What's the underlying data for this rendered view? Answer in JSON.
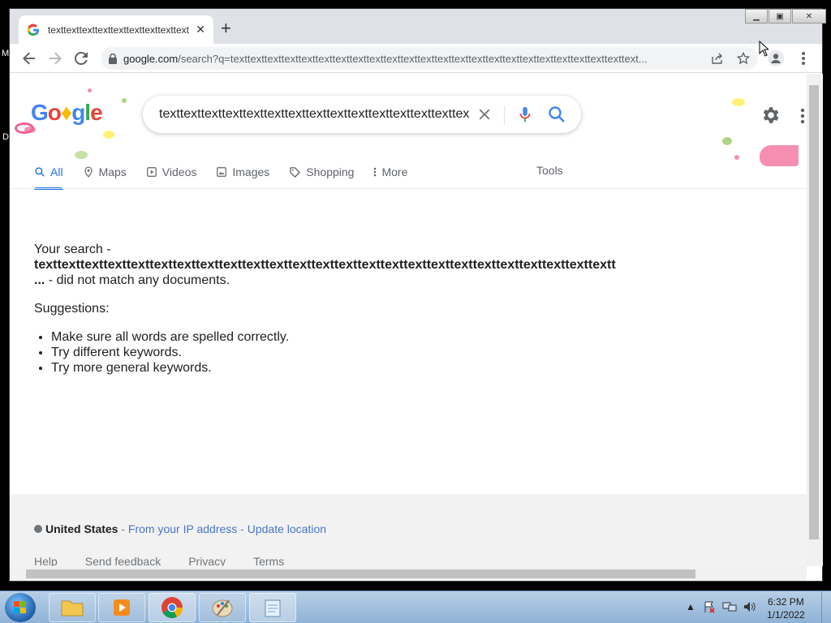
{
  "browser": {
    "tab_title": "texttexttexttexttexttexttexttexttexttexttexttext",
    "new_tab_label": "+",
    "url_domain": "google.com",
    "url_rest": "/search?q=texttexttexttexttexttexttexttexttexttexttexttexttexttexttexttexttexttexttexttexttexttexttexttext..."
  },
  "google": {
    "logo_text": "Google",
    "query": "texttexttexttexttexttexttexttexttexttexttexttexttexttexttexttexttext",
    "tabs": [
      {
        "label": "All",
        "icon": "search-icon"
      },
      {
        "label": "Maps",
        "icon": "map-pin-icon"
      },
      {
        "label": "Videos",
        "icon": "video-icon"
      },
      {
        "label": "Images",
        "icon": "image-icon"
      },
      {
        "label": "Shopping",
        "icon": "tag-icon"
      },
      {
        "label": "More",
        "icon": "more-vert-icon"
      }
    ],
    "tools_label": "Tools",
    "no_results": {
      "prefix": "Your search -",
      "term": "texttexttexttexttexttexttexttexttexttexttexttexttexttexttexttexttexttexttexttexttexttexttexttexttextt",
      "term_cont": "...",
      "suffix": " - did not match any documents.",
      "suggestions_label": "Suggestions:",
      "suggestions": [
        "Make sure all words are spelled correctly.",
        "Try different keywords.",
        "Try more general keywords."
      ]
    },
    "footer": {
      "country": "United States",
      "sep1": " - ",
      "ip_link": "From your IP address",
      "sep2": " - ",
      "update_link": "Update location",
      "links": [
        "Help",
        "Send feedback",
        "Privacy",
        "Terms"
      ]
    }
  },
  "taskbar": {
    "time": "6:32 PM",
    "date": "1/1/2022"
  },
  "desktop": {
    "letter_m": "M",
    "letter_d": "D"
  },
  "colors": {
    "accent_blue": "#1a73e8",
    "link_blue": "#4b74c4",
    "mic_red": "#ea4335"
  }
}
